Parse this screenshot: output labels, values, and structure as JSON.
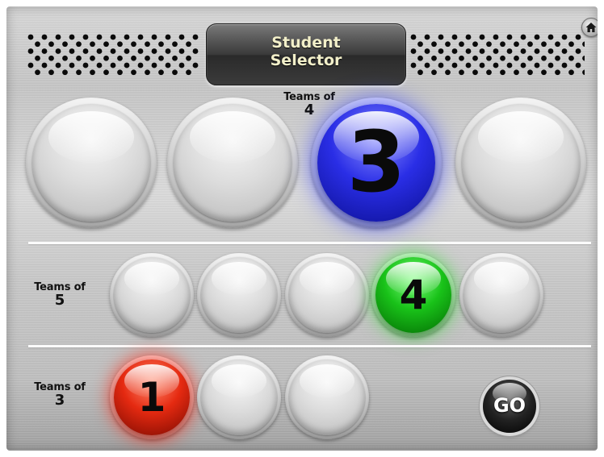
{
  "app": {
    "title": "Student\nSelector",
    "home_icon": "home-icon"
  },
  "rows": {
    "teams_of_4": {
      "label": "Teams of",
      "size": "4",
      "balls": [
        {
          "state": "empty",
          "number": ""
        },
        {
          "state": "empty",
          "number": ""
        },
        {
          "state": "selected",
          "color": "#2a2ee6",
          "number": "3"
        },
        {
          "state": "empty",
          "number": ""
        }
      ]
    },
    "teams_of_5": {
      "label": "Teams of",
      "size": "5",
      "balls": [
        {
          "state": "empty",
          "number": ""
        },
        {
          "state": "empty",
          "number": ""
        },
        {
          "state": "empty",
          "number": ""
        },
        {
          "state": "selected",
          "color": "#19c219",
          "number": "4"
        },
        {
          "state": "empty",
          "number": ""
        }
      ]
    },
    "teams_of_3": {
      "label": "Teams of",
      "size": "3",
      "balls": [
        {
          "state": "selected",
          "color": "#e52a11",
          "number": "1"
        },
        {
          "state": "empty",
          "number": ""
        },
        {
          "state": "empty",
          "number": ""
        }
      ]
    }
  },
  "go_button": {
    "label": "GO"
  }
}
